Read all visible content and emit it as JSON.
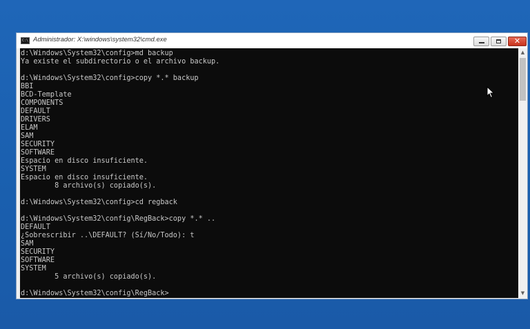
{
  "window": {
    "title": "Administrador: X:\\windows\\system32\\cmd.exe",
    "icon": "cmd-icon",
    "controls": [
      "minimize-icon",
      "maximize-icon",
      "close-icon"
    ]
  },
  "console": {
    "lines": [
      "d:\\Windows\\System32\\config>md backup",
      "Ya existe el subdirectorio o el archivo backup.",
      "",
      "d:\\Windows\\System32\\config>copy *.* backup",
      "BBI",
      "BCD-Template",
      "COMPONENTS",
      "DEFAULT",
      "DRIVERS",
      "ELAM",
      "SAM",
      "SECURITY",
      "SOFTWARE",
      "Espacio en disco insuficiente.",
      "SYSTEM",
      "Espacio en disco insuficiente.",
      "        8 archivo(s) copiado(s).",
      "",
      "d:\\Windows\\System32\\config>cd regback",
      "",
      "d:\\Windows\\System32\\config\\RegBack>copy *.* ..",
      "DEFAULT",
      "¿Sobrescribir ..\\DEFAULT? (Sí/No/Todo): t",
      "SAM",
      "SECURITY",
      "SOFTWARE",
      "SYSTEM",
      "        5 archivo(s) copiado(s).",
      "",
      "d:\\Windows\\System32\\config\\RegBack>"
    ]
  },
  "colors": {
    "desktop": "#1e63b5",
    "console_bg": "#0c0c0c",
    "console_fg": "#c8c8c8"
  }
}
